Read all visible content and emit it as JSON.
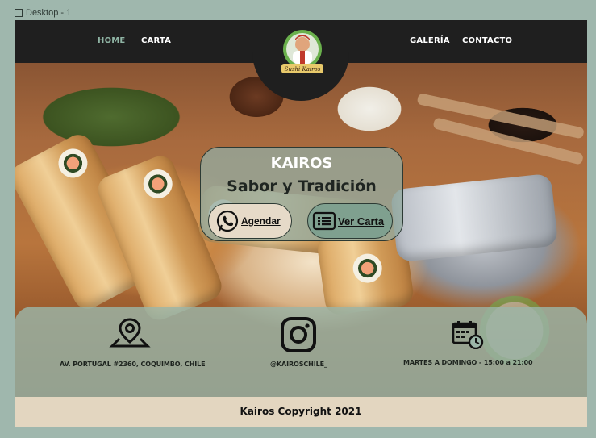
{
  "canvas": {
    "label": "Desktop - 1"
  },
  "nav": {
    "items": [
      {
        "label": "HOME",
        "active": true
      },
      {
        "label": "CARTA",
        "active": false
      },
      {
        "label": "GALERÍA",
        "active": false
      },
      {
        "label": "CONTACTO",
        "active": false
      }
    ],
    "logo_text": "Sushi Kairos"
  },
  "hero": {
    "title": "KAIROS",
    "subtitle": "Sabor y Tradición",
    "buttons": {
      "agendar": "Agendar",
      "ver_carta": "Ver Carta"
    }
  },
  "info": {
    "address": "AV. PORTUGAL #2360, COQUIMBO, CHILE",
    "instagram": "@KAIROSCHILE_",
    "hours": "MARTES A DOMINGO  -  15:00 a 21:00"
  },
  "footer": {
    "copyright": "Kairos Copyright 2021"
  },
  "colors": {
    "nav_bg": "#1f1f1f",
    "active_link": "#8fb4a4",
    "card_bg": "#94aaa0",
    "agendar_bg": "#e6dac8",
    "carta_bg": "#7fa08f",
    "footer_bg": "#e3d6c0",
    "page_bg": "#9fb7ad"
  },
  "icons": {
    "frame": "frame-icon",
    "whatsapp": "whatsapp-icon",
    "menu": "menu-card-icon",
    "location": "map-pin-icon",
    "instagram": "instagram-icon",
    "calendar": "calendar-clock-icon"
  }
}
